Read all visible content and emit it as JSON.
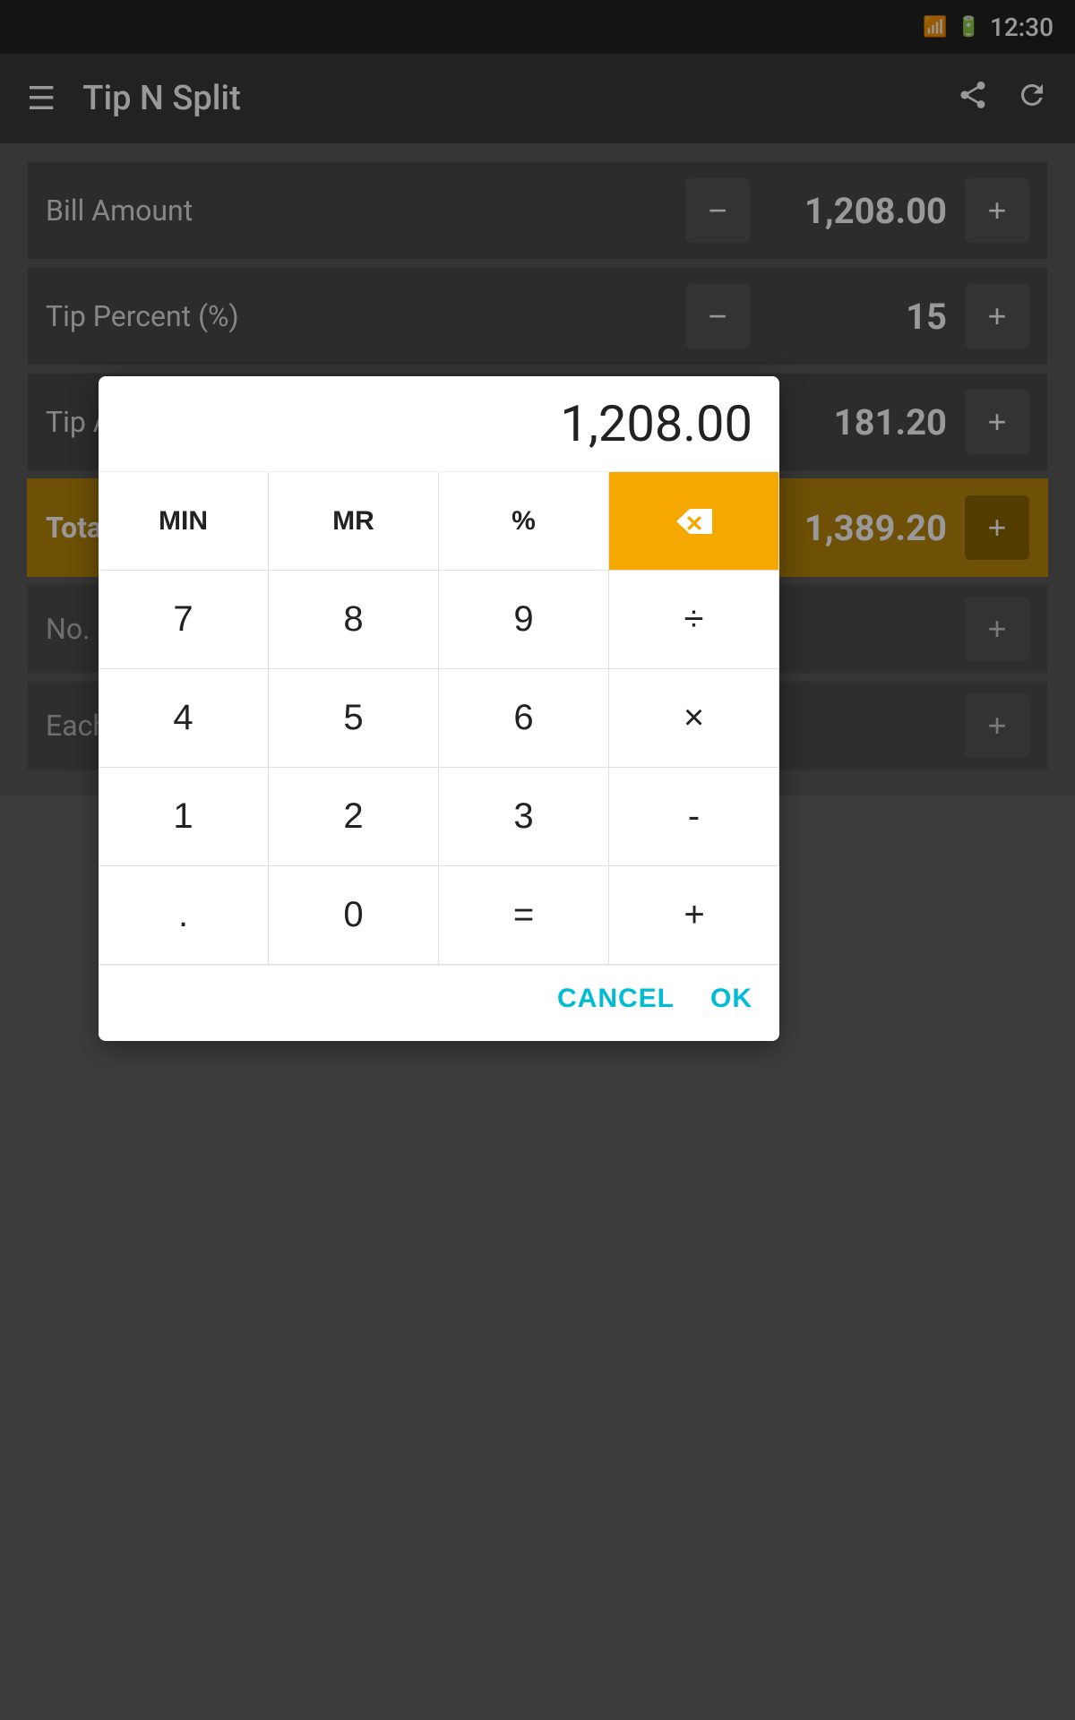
{
  "statusBar": {
    "time": "12:30"
  },
  "appBar": {
    "title": "Tip N Split",
    "hamburgerIcon": "☰",
    "shareIcon": "⬆",
    "refreshIcon": "↻"
  },
  "rows": [
    {
      "label": "Bill Amount",
      "value": "1,208.00"
    },
    {
      "label": "Tip Percent (%)",
      "value": "15"
    },
    {
      "label": "Tip Amount",
      "value": "181.20"
    },
    {
      "label": "Total Amount",
      "value": "1,389.20",
      "isTotal": true
    },
    {
      "label": "No. of P",
      "value": "",
      "partial": true
    },
    {
      "label": "Each Pe",
      "value": "",
      "partial": true
    }
  ],
  "calculator": {
    "display": "1,208.00",
    "buttons": [
      {
        "label": "MIN",
        "type": "special"
      },
      {
        "label": "MR",
        "type": "special"
      },
      {
        "label": "%",
        "type": "special"
      },
      {
        "label": "⌫",
        "type": "backspace"
      },
      {
        "label": "7",
        "type": "number"
      },
      {
        "label": "8",
        "type": "number"
      },
      {
        "label": "9",
        "type": "number"
      },
      {
        "label": "÷",
        "type": "operator"
      },
      {
        "label": "4",
        "type": "number"
      },
      {
        "label": "5",
        "type": "number"
      },
      {
        "label": "6",
        "type": "number"
      },
      {
        "label": "×",
        "type": "operator"
      },
      {
        "label": "1",
        "type": "number"
      },
      {
        "label": "2",
        "type": "number"
      },
      {
        "label": "3",
        "type": "number"
      },
      {
        "label": "-",
        "type": "operator"
      },
      {
        "label": ".",
        "type": "number"
      },
      {
        "label": "0",
        "type": "number"
      },
      {
        "label": "=",
        "type": "operator"
      },
      {
        "label": "+",
        "type": "operator"
      }
    ],
    "cancelLabel": "CANCEL",
    "okLabel": "OK"
  }
}
